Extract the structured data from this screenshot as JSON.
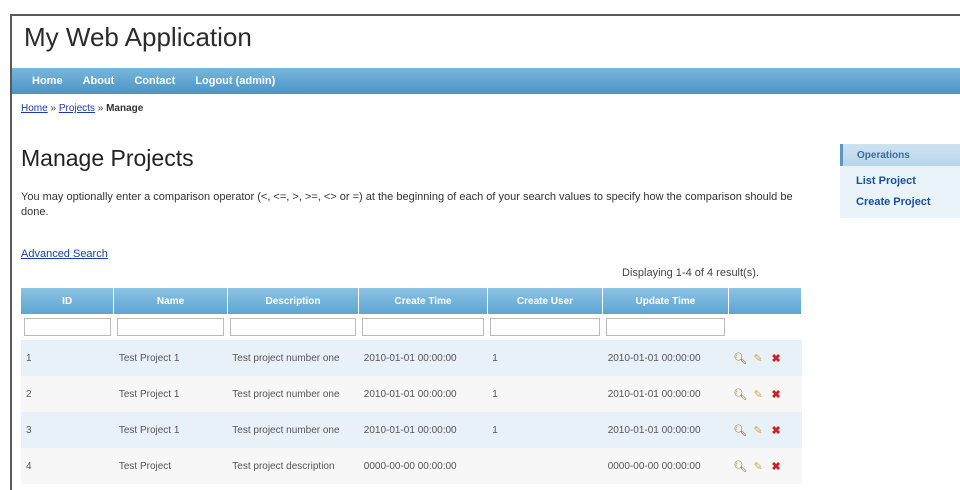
{
  "app": {
    "title": "My Web Application"
  },
  "menu": [
    "Home",
    "About",
    "Contact",
    "Logout (admin)"
  ],
  "breadcrumb": {
    "home": "Home",
    "sep1": "»",
    "projects": "Projects",
    "sep2": "»",
    "current": "Manage"
  },
  "page": {
    "title": "Manage Projects",
    "intro": "You may optionally enter a comparison operator (<, <=, >, >=, <> or =) at the beginning of each of your search values to specify how the comparison should be done.",
    "advanced_search": "Advanced Search",
    "summary": "Displaying 1-4 of 4 result(s)."
  },
  "grid": {
    "columns": [
      "ID",
      "Name",
      "Description",
      "Create Time",
      "Create User",
      "Update Time"
    ],
    "rows": [
      [
        "1",
        "Test Project 1",
        "Test project number one",
        "2010-01-01 00:00:00",
        "1",
        "2010-01-01 00:00:00"
      ],
      [
        "2",
        "Test Project 1",
        "Test project number one",
        "2010-01-01 00:00:00",
        "1",
        "2010-01-01 00:00:00"
      ],
      [
        "3",
        "Test Project 1",
        "Test project number one",
        "2010-01-01 00:00:00",
        "1",
        "2010-01-01 00:00:00"
      ],
      [
        "4",
        "Test Project",
        "Test project description",
        "0000-00-00 00:00:00",
        "",
        "0000-00-00 00:00:00"
      ]
    ],
    "icons": [
      "magnifier-icon",
      "pencil-icon",
      "delete-icon"
    ]
  },
  "sidebar": {
    "title": "Operations",
    "items": [
      "List Project",
      "Create Project"
    ]
  }
}
